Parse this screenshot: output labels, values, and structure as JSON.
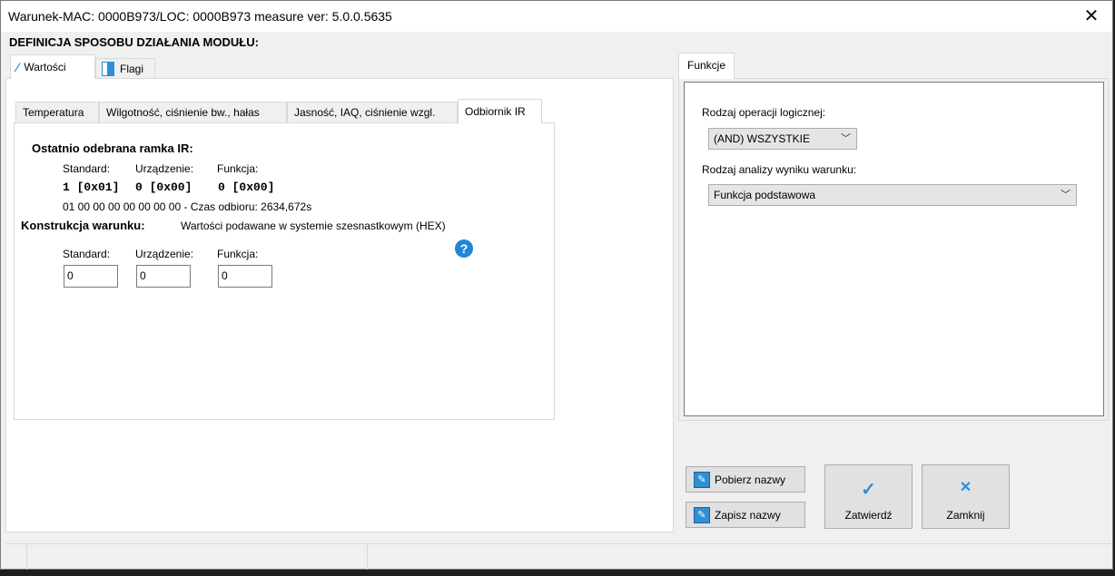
{
  "window": {
    "title": "Warunek-MAC: 0000B973/LOC: 0000B973 measure ver: 5.0.0.5635",
    "close_glyph": "✕"
  },
  "heading": "DEFINICJA SPOSOBU DZIAŁANIA MODUŁU:",
  "main_tabs": [
    {
      "label": "Wartości"
    },
    {
      "label": "Flagi"
    }
  ],
  "sub_tabs": [
    {
      "label": "Temperatura"
    },
    {
      "label": "Wilgotność, ciśnienie bw., hałas"
    },
    {
      "label": "Jasność, IAQ, ciśnienie wzgl."
    },
    {
      "label": "Odbiornik IR"
    }
  ],
  "ir": {
    "last_frame_title": "Ostatnio odebrana ramka IR:",
    "col_standard": "Standard:",
    "col_device": "Urządzenie:",
    "col_function": "Funkcja:",
    "val_standard": "1 [0x01]",
    "val_device": "0 [0x00]",
    "val_function": "0 [0x00]",
    "raw_frame": "01 00 00 00 00 00 00 00 - Czas odbioru: 2634,672s",
    "construction_title": "Konstrukcja warunku:",
    "construction_note": "Wartości podawane w systemie szesnastkowym (HEX)",
    "in_standard_label": "Standard:",
    "in_device_label": "Urządzenie:",
    "in_function_label": "Funkcja:",
    "in_standard": "0",
    "in_device": "0",
    "in_function": "0",
    "help_glyph": "?"
  },
  "right": {
    "tab_label": "Funkcje",
    "logic_label": "Rodzaj operacji logicznej:",
    "logic_value": "(AND) WSZYSTKIE",
    "analysis_label": "Rodzaj analizy wyniku warunku:",
    "analysis_value": "Funkcja podstawowa"
  },
  "buttons": {
    "fetch_names": "Pobierz nazwy",
    "save_names": "Zapisz nazwy",
    "confirm": "Zatwierdź",
    "close": "Zamknij",
    "confirm_glyph": "✓",
    "close_glyph": "✕"
  },
  "colors": {
    "accent": "#2f8fd6",
    "help": "#1e88d6"
  }
}
